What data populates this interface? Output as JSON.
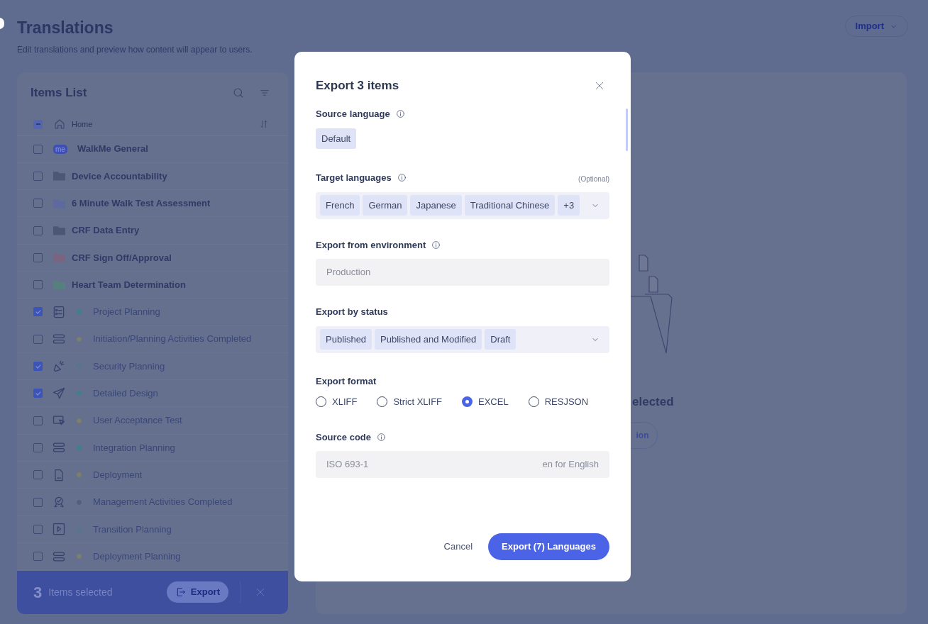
{
  "page": {
    "title": "Translations",
    "subtitle": "Edit translations and preview how content will appear to users.",
    "import_button": "Import"
  },
  "items_list": {
    "title": "Items List",
    "breadcrumb": {
      "label": "Home",
      "indeterminate": true
    },
    "items": [
      {
        "kind": "app",
        "name": "WalkMe General",
        "icon_text": "me",
        "checked": false
      },
      {
        "kind": "folder",
        "name": "Device Accountability",
        "color": "#4c5677",
        "checked": false
      },
      {
        "kind": "folder",
        "name": "6 Minute Walk Test Assessment",
        "color": "#5d6aa0",
        "checked": false
      },
      {
        "kind": "folder",
        "name": "CRF Data Entry",
        "color": "#4c5677",
        "checked": false
      },
      {
        "kind": "folder",
        "name": "CRF Sign Off/Approval",
        "color": "#7a6482",
        "checked": false
      },
      {
        "kind": "folder",
        "name": "Heart Team Determination",
        "color": "#55807e",
        "checked": false
      },
      {
        "kind": "item",
        "name": "Project Planning",
        "color": "#3f7f8f",
        "dot_filled": true,
        "checked": true
      },
      {
        "kind": "item",
        "name": "Initiation/Planning Activities Completed",
        "color": "#7c7f6a",
        "dot_filled": true,
        "checked": false
      },
      {
        "kind": "item",
        "name": "Security Planning",
        "color": "#3f7f8f",
        "dot_filled": false,
        "checked": true
      },
      {
        "kind": "item",
        "name": "Detailed Design",
        "color": "#3f7f8f",
        "dot_filled": true,
        "checked": true
      },
      {
        "kind": "item",
        "name": "User Acceptance Test",
        "color": "#7c7f6a",
        "dot_filled": true,
        "checked": false
      },
      {
        "kind": "item",
        "name": "Integration Planning",
        "color": "#3f7f8f",
        "dot_filled": true,
        "checked": false
      },
      {
        "kind": "item",
        "name": "Deployment",
        "color": "#7c7f6a",
        "dot_filled": true,
        "checked": false
      },
      {
        "kind": "item",
        "name": "Management Activities Completed",
        "color": "#545e80",
        "dot_filled": true,
        "checked": false
      },
      {
        "kind": "item",
        "name": "Transition Planning",
        "color": "#3f7f8f",
        "dot_filled": false,
        "checked": false
      },
      {
        "kind": "item",
        "name": "Deployment Planning",
        "color": "#7c7f6a",
        "dot_filled": true,
        "checked": false
      }
    ]
  },
  "selection_bar": {
    "count": "3",
    "label": "Items selected",
    "export_button": "Export"
  },
  "preview_panel": {
    "empty_title": "elected",
    "button": "ion"
  },
  "dialog": {
    "title": "Export 3 items",
    "source_language": {
      "label": "Source language",
      "info": true,
      "chips": [
        "Default"
      ]
    },
    "target_languages": {
      "label": "Target languages",
      "info": true,
      "optional": "(Optional)",
      "chips": [
        "French",
        "German",
        "Japanese",
        "Traditional Chinese",
        "+3"
      ]
    },
    "environment": {
      "label": "Export from environment",
      "info": true,
      "placeholder": "Production",
      "disabled": true
    },
    "status": {
      "label": "Export by status",
      "chips": [
        "Published",
        "Published and Modified",
        "Draft"
      ]
    },
    "format": {
      "label": "Export format",
      "options": [
        {
          "label": "XLIFF",
          "selected": false
        },
        {
          "label": "Strict XLIFF",
          "selected": false
        },
        {
          "label": "EXCEL",
          "selected": true
        },
        {
          "label": "RESJSON",
          "selected": false
        }
      ]
    },
    "source_code": {
      "label": "Source code",
      "info": true,
      "placeholder": "ISO 693-1",
      "hint": "en for English"
    },
    "cancel": "Cancel",
    "submit": "Export (7) Languages"
  }
}
